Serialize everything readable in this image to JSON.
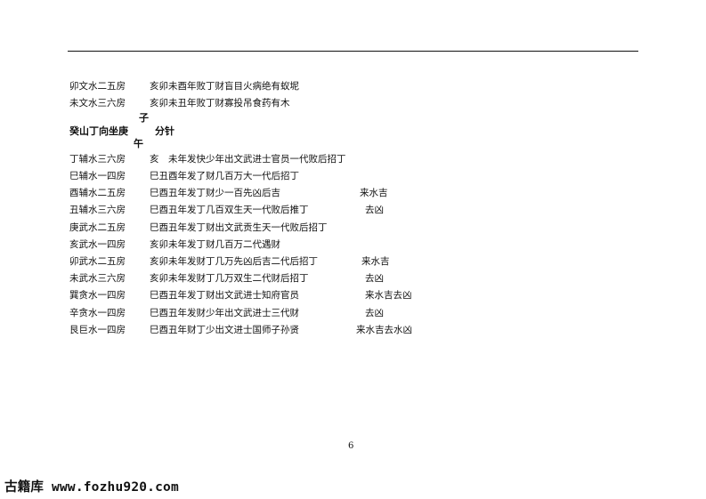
{
  "lines_before": [
    {
      "col1": "卯文水二五房",
      "col2": "亥卯未酉年败丁财盲目火病绝有蚁坭"
    },
    {
      "col1": "未文水三六房",
      "col2": "亥卯未丑年败丁财寡投吊食药有木"
    }
  ],
  "heading": {
    "top_char": "子",
    "main": "癸山丁向坐庚",
    "side": "分针",
    "bottom_char": "午"
  },
  "lines_after": [
    {
      "col1": "丁辅水三六房",
      "col2": "亥　未年发快少年出文武进士官员一代败后招丁",
      "col3": ""
    },
    {
      "col1": "巳辅水一四房",
      "col2": "巳丑酉年发了财几百万大一代后招丁",
      "col3": ""
    },
    {
      "col1": "酉辅水二五房",
      "col2": "巳酉丑年发丁财少一百先凶后吉",
      "col3": "来水吉"
    },
    {
      "col1": "丑辅水三六房",
      "col2": "巳酉丑年发丁几百双生天一代败后推丁",
      "col3": "去凶"
    },
    {
      "col1": "庚武水二五房",
      "col2": "巳酉丑年发丁财出文武贡生天一代败后招丁",
      "col3": ""
    },
    {
      "col1": "亥武水一四房",
      "col2": "亥卯未年发丁财几百万二代遇财",
      "col3": ""
    },
    {
      "col1": "卯武水二五房",
      "col2": "亥卯未年发财丁几万先凶后吉二代后招丁",
      "col3": "来水吉"
    },
    {
      "col1": "未武水三六房",
      "col2": "亥卯未年发财丁几万双生二代财后招丁",
      "col3": "去凶"
    },
    {
      "col1": "巽贪水一四房",
      "col2": "巳酉丑年发丁财出文武进士知府官员",
      "col3": "来水吉去凶"
    },
    {
      "col1": "辛贪水一四房",
      "col2": "巳酉丑年发财少年出文武进士三代财",
      "col3": "去凶"
    },
    {
      "col1": "艮巨水一四房",
      "col2": "巳酉丑年财丁少出文进士国师子孙贤",
      "col3": "来水吉去水凶"
    }
  ],
  "page_number": "6",
  "watermark": "古籍库 www.fozhu920.com"
}
